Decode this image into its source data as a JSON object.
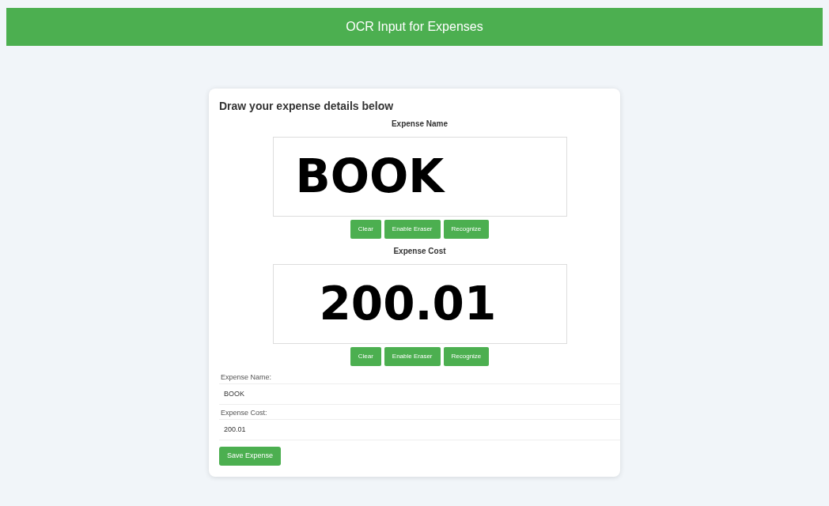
{
  "header": {
    "title": "OCR Input for Expenses"
  },
  "card": {
    "title": "Draw your expense details below"
  },
  "pads": [
    {
      "label": "Expense Name",
      "ink": "BOOK",
      "buttons": [
        "Clear",
        "Enable Eraser",
        "Recognize"
      ]
    },
    {
      "label": "Expense Cost",
      "ink": "200.01",
      "buttons": [
        "Clear",
        "Enable Eraser",
        "Recognize"
      ]
    }
  ],
  "fields": [
    {
      "label": "Expense Name:",
      "value": "BOOK"
    },
    {
      "label": "Expense Cost:",
      "value": "200.01"
    }
  ],
  "save_button": "Save Expense"
}
